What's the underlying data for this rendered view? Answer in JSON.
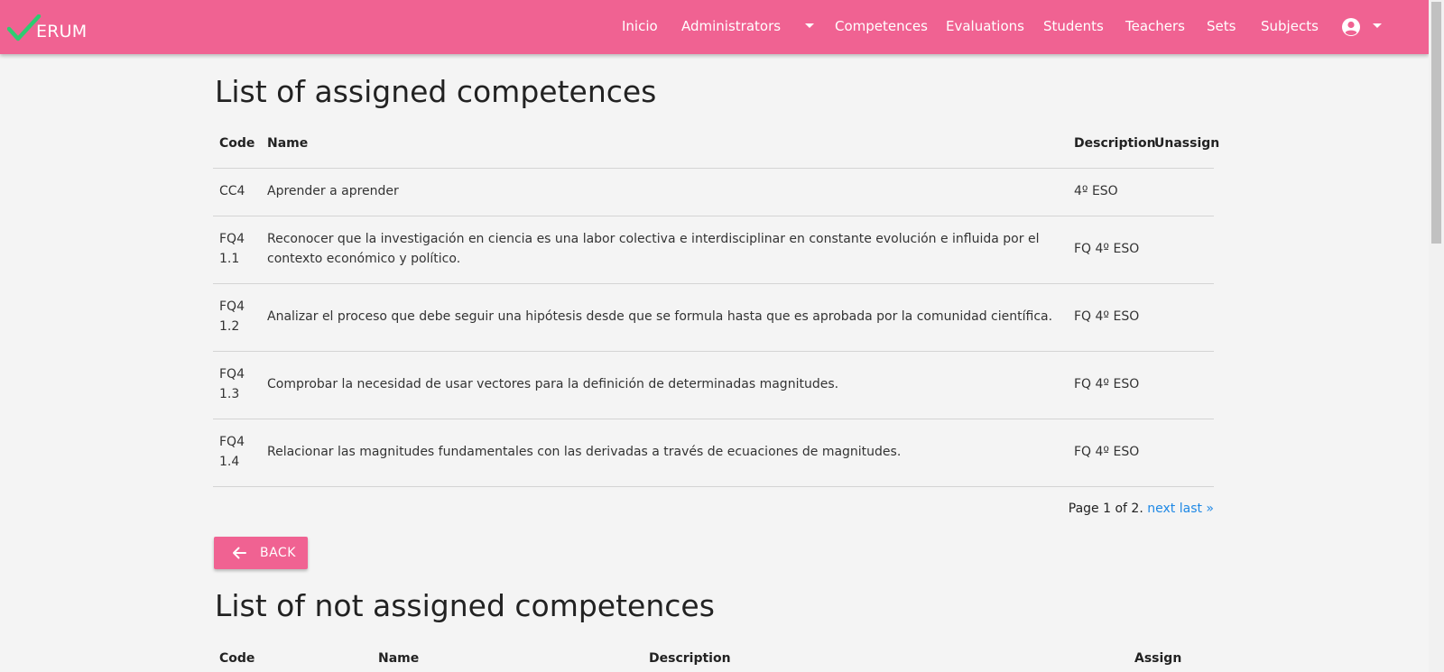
{
  "brand": {
    "text": "ERUM",
    "accent": "#f06292",
    "check_color": "#2ecc71"
  },
  "nav": {
    "inicio": "Inicio",
    "administrators": "Administrators",
    "competences": "Competences",
    "evaluations": "Evaluations",
    "students": "Students",
    "teachers": "Teachers",
    "sets": "Sets",
    "subjects": "Subjects",
    "account_icon": "account-circle-icon"
  },
  "assigned": {
    "title": "List of assigned competences",
    "headers": {
      "code": "Code",
      "name": "Name",
      "description": "Description",
      "unassign": "Unassign"
    },
    "rows": [
      {
        "code": "CC4",
        "name": "Aprender a aprender",
        "description": "4º ESO"
      },
      {
        "code": "FQ4 1.1",
        "name": "Reconocer que la investigación en ciencia es una labor colectiva e interdisciplinar en constante evolución e influida por el contexto económico y político.",
        "description": "FQ 4º ESO"
      },
      {
        "code": "FQ4 1.2",
        "name": "Analizar el proceso que debe seguir una hipótesis desde que se formula hasta que es aprobada por la comunidad científica.",
        "description": "FQ 4º ESO"
      },
      {
        "code": "FQ4 1.3",
        "name": "Comprobar la necesidad de usar vectores para la definición de determinadas magnitudes.",
        "description": "FQ 4º ESO"
      },
      {
        "code": "FQ4 1.4",
        "name": "Relacionar las magnitudes fundamentales con las derivadas a través de ecuaciones de magnitudes.",
        "description": "FQ 4º ESO"
      }
    ],
    "pagination": {
      "text": "Page 1 of 2.",
      "next": "next",
      "last": "last »"
    }
  },
  "back_button": {
    "label": "BACK",
    "icon": "arrow-left-icon"
  },
  "not_assigned": {
    "title": "List of not assigned competences",
    "headers": {
      "code": "Code",
      "name": "Name",
      "description": "Description",
      "assign": "Assign"
    }
  }
}
